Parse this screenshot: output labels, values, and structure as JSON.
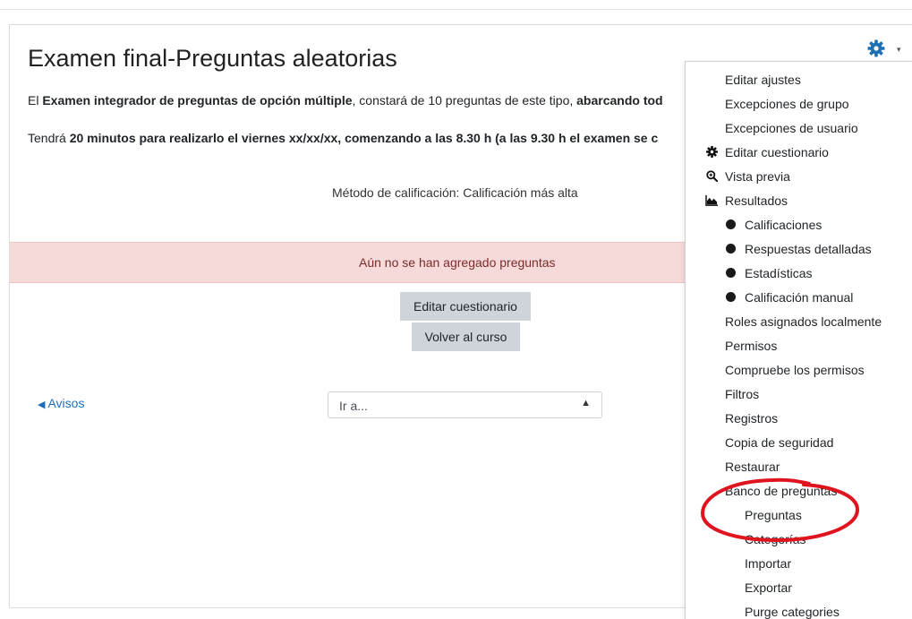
{
  "page": {
    "title": "Examen final-Preguntas aleatorias",
    "intro_line1": {
      "p1": "El ",
      "b1": "Examen integrador de preguntas de opción múltiple",
      "p2": ", constará de 10 preguntas de este tipo, ",
      "b2": "abarcando tod"
    },
    "intro_line2": {
      "p1": "Tendrá ",
      "b1": "20 minutos para realizarlo el viernes xx/xx/xx, comenzando a las 8.30 h (a las 9.30 h el examen se c"
    },
    "grading_method": "Método de calificación: Calificación más alta",
    "alert_text": "Aún no se han agregado preguntas",
    "edit_quiz_button": "Editar cuestionario",
    "back_to_course_button": "Volver al curso",
    "prev_activity_link": "Avisos",
    "jump_select": {
      "value": "Ir a..."
    }
  },
  "colors": {
    "gear": "#1f6fb5",
    "link": "#1f6fb5",
    "alert_bg": "#f6dada",
    "button_bg": "#ced4da",
    "annotation_circle": "#e0141e"
  },
  "settings_menu": {
    "items": [
      {
        "label": "Editar ajustes",
        "icon": ""
      },
      {
        "label": "Excepciones de grupo",
        "icon": ""
      },
      {
        "label": "Excepciones de usuario",
        "icon": ""
      },
      {
        "label": "Editar cuestionario",
        "icon": "gear-icon"
      },
      {
        "label": "Vista previa",
        "icon": "magnifier-icon"
      },
      {
        "label": "Resultados",
        "icon": "area-chart-icon"
      },
      {
        "label": "Calificaciones",
        "icon": "bullet-icon"
      },
      {
        "label": "Respuestas detalladas",
        "icon": "bullet-icon"
      },
      {
        "label": "Estadísticas",
        "icon": "bullet-icon"
      },
      {
        "label": "Calificación manual",
        "icon": "bullet-icon"
      },
      {
        "label": "Roles asignados localmente",
        "icon": ""
      },
      {
        "label": "Permisos",
        "icon": ""
      },
      {
        "label": "Compruebe los permisos",
        "icon": ""
      },
      {
        "label": "Filtros",
        "icon": ""
      },
      {
        "label": "Registros",
        "icon": ""
      },
      {
        "label": "Copia de seguridad",
        "icon": ""
      },
      {
        "label": "Restaurar",
        "icon": ""
      },
      {
        "label": "Banco de preguntas",
        "icon": ""
      },
      {
        "label": "Preguntas",
        "icon": ""
      },
      {
        "label": "Categorías",
        "icon": ""
      },
      {
        "label": "Importar",
        "icon": ""
      },
      {
        "label": "Exportar",
        "icon": ""
      },
      {
        "label": "Purge categories",
        "icon": ""
      }
    ]
  }
}
